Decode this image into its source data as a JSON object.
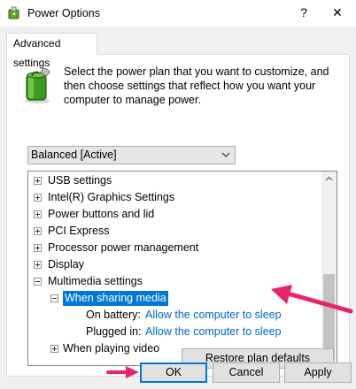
{
  "window": {
    "title": "Power Options",
    "help_glyph": "?",
    "close_glyph": "✕"
  },
  "tab": {
    "label": "Advanced settings"
  },
  "description": "Select the power plan that you want to customize, and then choose settings that reflect how you want your computer to manage power.",
  "plan_select": {
    "value": "Balanced [Active]"
  },
  "tree": {
    "items": [
      {
        "label": "USB settings",
        "expander": "+"
      },
      {
        "label": "Intel(R) Graphics Settings",
        "expander": "+"
      },
      {
        "label": "Power buttons and lid",
        "expander": "+"
      },
      {
        "label": "PCI Express",
        "expander": "+"
      },
      {
        "label": "Processor power management",
        "expander": "+"
      },
      {
        "label": "Display",
        "expander": "+"
      },
      {
        "label": "Multimedia settings",
        "expander": "-"
      }
    ],
    "child": {
      "label": "When sharing media",
      "expander": "-"
    },
    "values": [
      {
        "label": "On battery:",
        "value": "Allow the computer to sleep"
      },
      {
        "label": "Plugged in:",
        "value": "Allow the computer to sleep"
      }
    ],
    "partial_item": {
      "label": "When playing video",
      "expander": "+"
    }
  },
  "buttons": {
    "restore": "Restore plan defaults",
    "ok": "OK",
    "cancel": "Cancel",
    "apply": "Apply"
  },
  "colors": {
    "selection": "#0078d7",
    "link": "#0066cc",
    "annotation_arrow": "#e8246e"
  }
}
